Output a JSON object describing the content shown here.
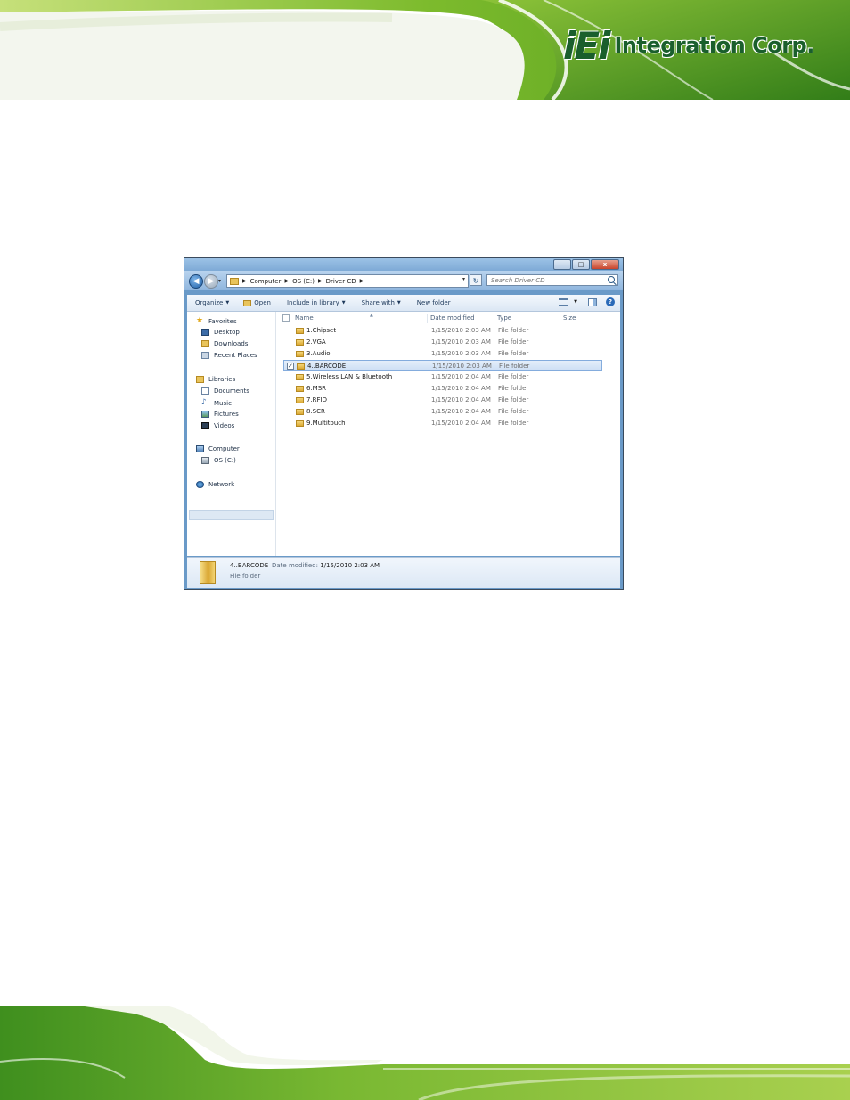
{
  "brand": {
    "logo_mark": "iEi",
    "logo_text": "Integration Corp."
  },
  "window": {
    "buttons": {
      "minimize": "–",
      "maximize": "□",
      "close": "x"
    }
  },
  "address": {
    "breadcrumbs": [
      "Computer",
      "OS (C:)",
      "Driver CD"
    ],
    "search_placeholder": "Search Driver CD"
  },
  "toolbar": {
    "organize": "Organize",
    "open": "Open",
    "include_in_library": "Include in library",
    "share_with": "Share with",
    "new_folder": "New folder"
  },
  "nav_pane": {
    "favorites": "Favorites",
    "desktop": "Desktop",
    "downloads": "Downloads",
    "recent_places": "Recent Places",
    "libraries": "Libraries",
    "documents": "Documents",
    "music": "Music",
    "pictures": "Pictures",
    "videos": "Videos",
    "computer": "Computer",
    "os_drive": "OS (C:)",
    "network": "Network"
  },
  "columns": {
    "name": "Name",
    "date_modified": "Date modified",
    "type": "Type",
    "size": "Size"
  },
  "files": [
    {
      "name": "1.Chipset",
      "date": "1/15/2010 2:03 AM",
      "type": "File folder"
    },
    {
      "name": "2.VGA",
      "date": "1/15/2010 2:03 AM",
      "type": "File folder"
    },
    {
      "name": "3.Audio",
      "date": "1/15/2010 2:03 AM",
      "type": "File folder"
    },
    {
      "name": "4..BARCODE",
      "date": "1/15/2010 2:03 AM",
      "type": "File folder",
      "selected": true
    },
    {
      "name": "5.Wireless LAN & Bluetooth",
      "date": "1/15/2010 2:04 AM",
      "type": "File folder"
    },
    {
      "name": "6.MSR",
      "date": "1/15/2010 2:04 AM",
      "type": "File folder"
    },
    {
      "name": "7.RFID",
      "date": "1/15/2010 2:04 AM",
      "type": "File folder"
    },
    {
      "name": "8.SCR",
      "date": "1/15/2010 2:04 AM",
      "type": "File folder"
    },
    {
      "name": "9.Multitouch",
      "date": "1/15/2010 2:04 AM",
      "type": "File folder"
    }
  ],
  "details": {
    "name": "4..BARCODE",
    "date_label": "Date modified:",
    "date_value": "1/15/2010 2:03 AM",
    "type": "File folder"
  }
}
